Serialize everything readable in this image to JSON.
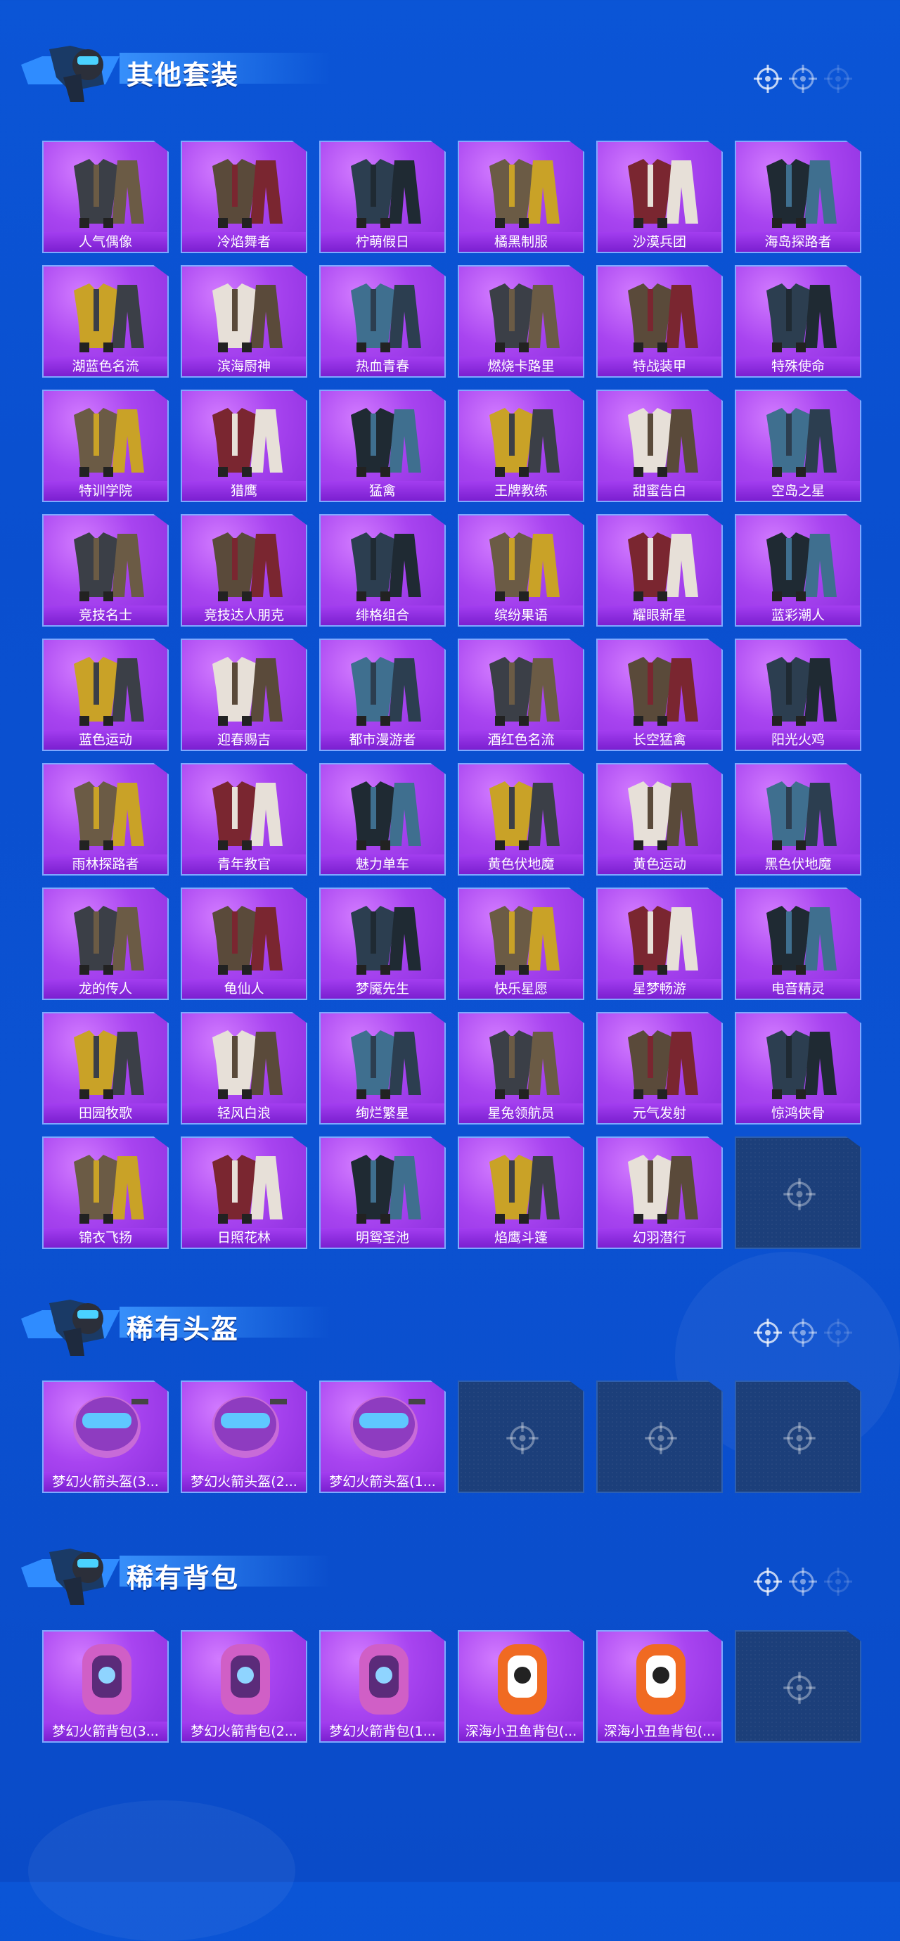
{
  "colors": {
    "background": "#0b55d6",
    "card_purple": "#a844f0",
    "card_label": "#7b1fd0",
    "empty_slot": "#1c3f7a",
    "header_accent": "#3c96ff"
  },
  "sections": [
    {
      "title": "其他套装",
      "items": [
        "人气偶像",
        "冷焰舞者",
        "柠萌假日",
        "橘黑制服",
        "沙漠兵团",
        "海岛探路者",
        "湖蓝色名流",
        "滨海厨神",
        "热血青春",
        "燃烧卡路里",
        "特战装甲",
        "特殊使命",
        "特训学院",
        "猎鹰",
        "猛禽",
        "王牌教练",
        "甜蜜告白",
        "空岛之星",
        "竞技名士",
        "竞技达人朋克",
        "绯格组合",
        "缤纷果语",
        "耀眼新星",
        "蓝彩潮人",
        "蓝色运动",
        "迎春赐吉",
        "都市漫游者",
        "酒红色名流",
        "长空猛禽",
        "阳光火鸡",
        "雨林探路者",
        "青年教官",
        "魅力单车",
        "黄色伏地魔",
        "黄色运动",
        "黑色伏地魔",
        "龙的传人",
        "龟仙人",
        "梦魇先生",
        "快乐星愿",
        "星梦畅游",
        "电音精灵",
        "田园牧歌",
        "轻风白浪",
        "绚烂繁星",
        "星兔领航员",
        "元气发射",
        "惊鸿侠骨",
        "锦衣飞扬",
        "日照花林",
        "明鸳圣池",
        "焰鹰斗篷",
        "幻羽潜行"
      ],
      "empty_slots": 1
    },
    {
      "title": "稀有头盔",
      "items": [
        "梦幻火箭头盔(3...",
        "梦幻火箭头盔(2...",
        "梦幻火箭头盔(1..."
      ],
      "empty_slots": 3
    },
    {
      "title": "稀有背包",
      "items": [
        "梦幻火箭背包(3...",
        "梦幻火箭背包(2...",
        "梦幻火箭背包(1...",
        "深海小丑鱼背包(...",
        "深海小丑鱼背包(..."
      ],
      "empty_slots": 1
    }
  ],
  "icons": {
    "header_emblem": "soldier-emblem-icon",
    "header_targets": "crosshair-icon",
    "empty_slot": "crosshair-icon"
  }
}
